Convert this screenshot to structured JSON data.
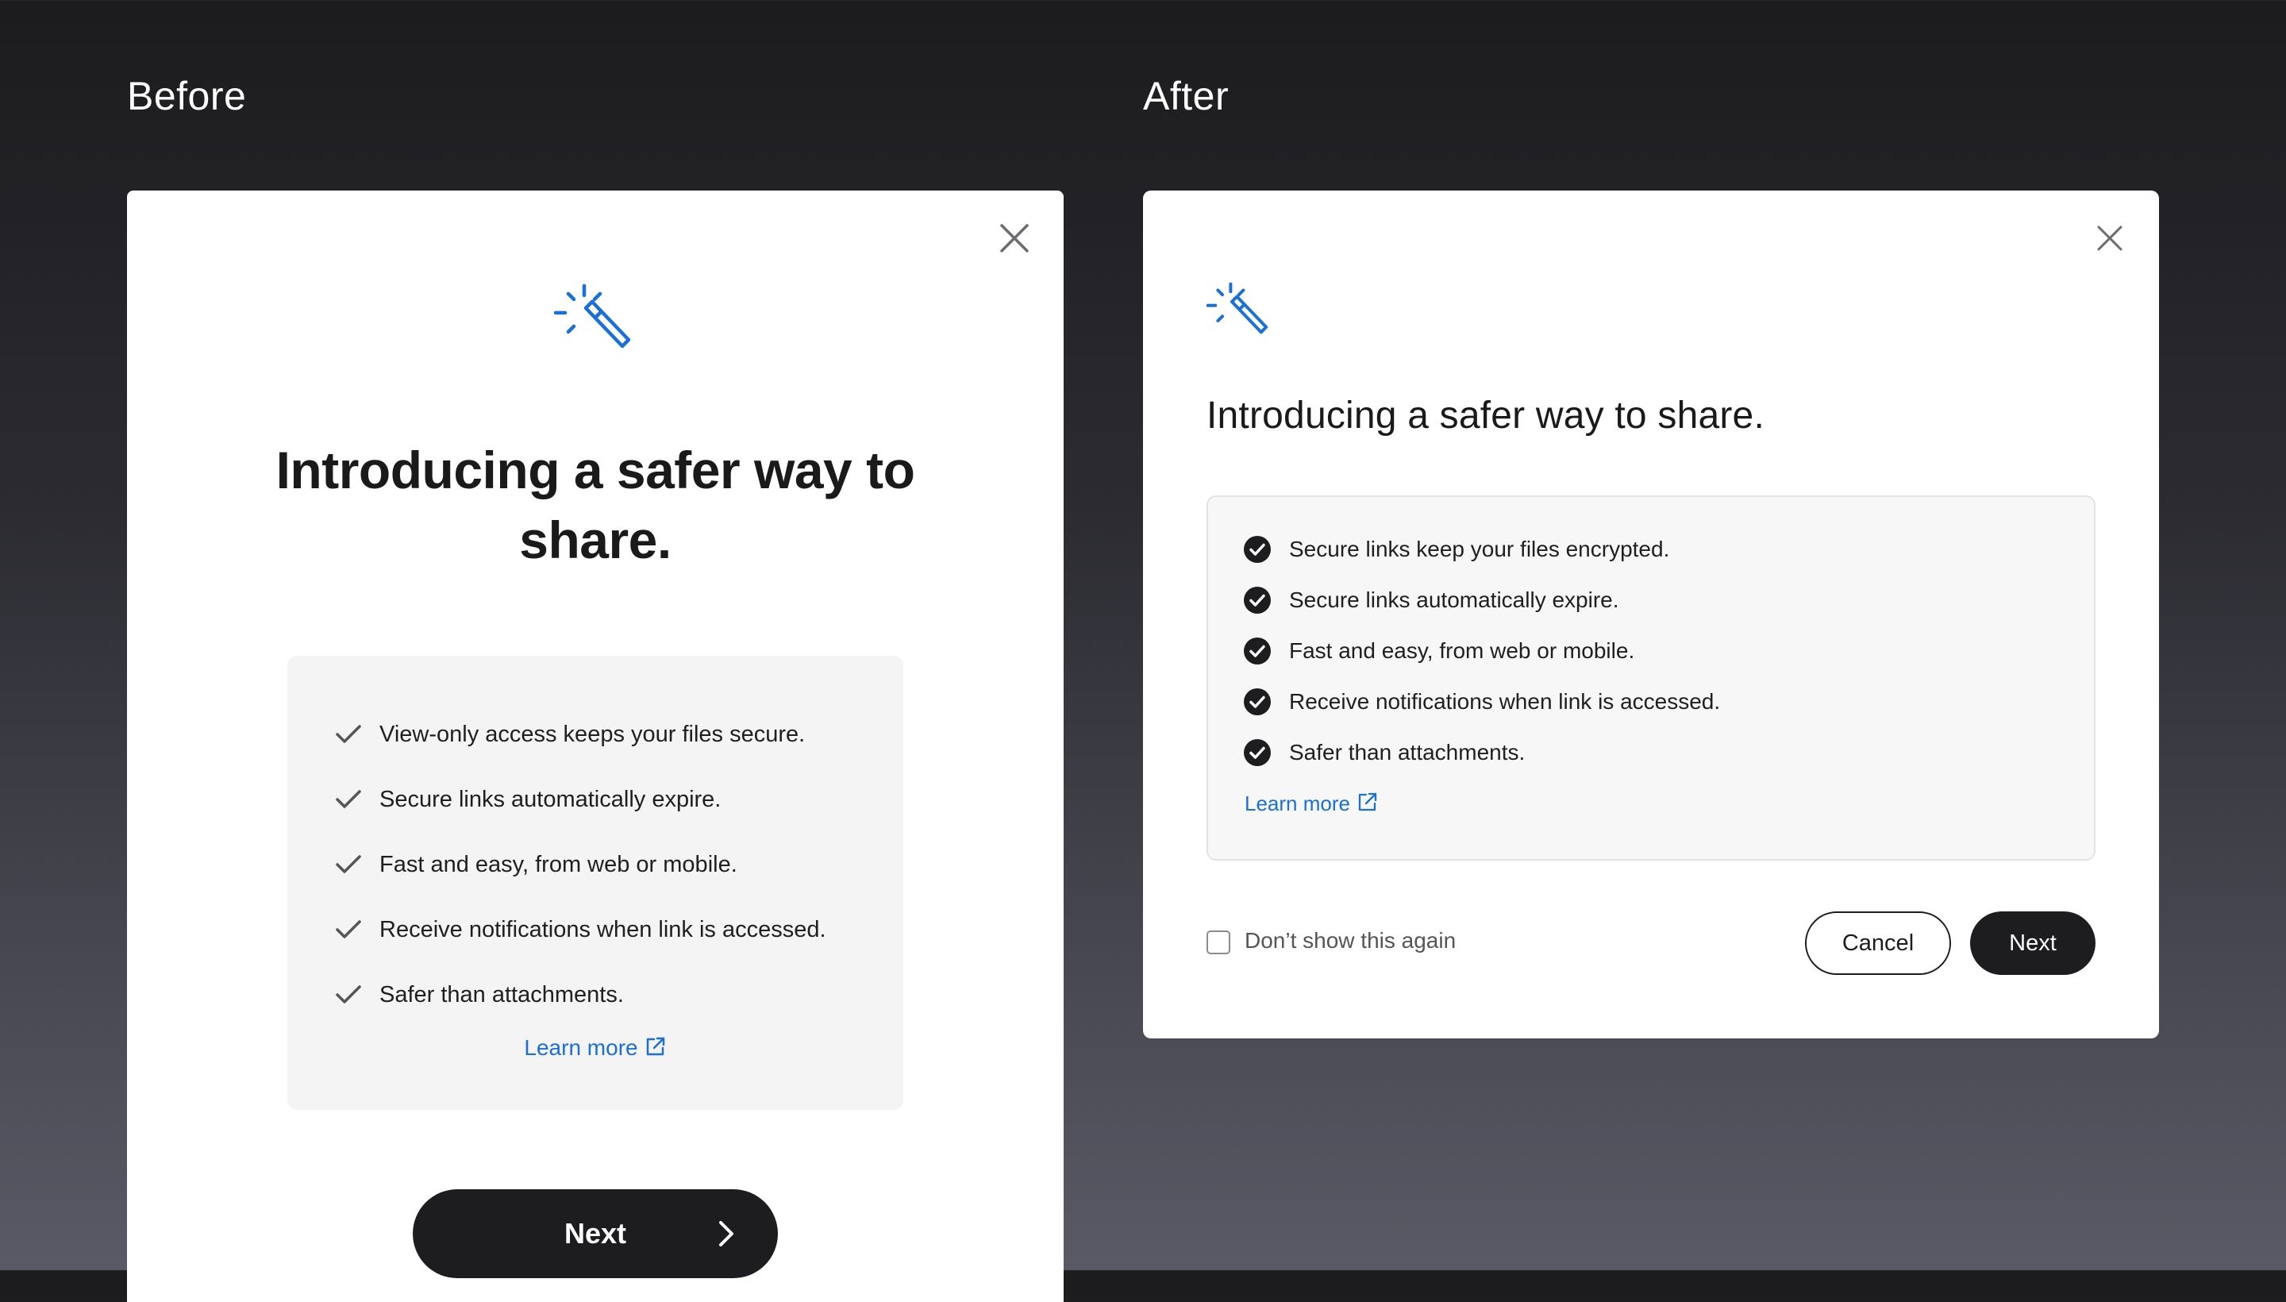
{
  "labels": {
    "before": "Before",
    "after": "After"
  },
  "before": {
    "title": "Introducing a safer way to share.",
    "features": [
      "View-only access keeps your files secure.",
      "Secure links automatically expire.",
      "Fast and easy, from web or mobile.",
      "Receive notifications when link is accessed.",
      "Safer than attachments."
    ],
    "learn_more": "Learn more",
    "next_label": "Next"
  },
  "after": {
    "title": "Introducing a safer way to share.",
    "features": [
      "Secure links keep your files encrypted.",
      "Secure links automatically expire.",
      "Fast and easy, from web or mobile.",
      "Receive notifications when link is accessed.",
      "Safer than attachments."
    ],
    "learn_more": "Learn more",
    "dont_show": "Don’t show this again",
    "dont_show_checked": false,
    "cancel_label": "Cancel",
    "next_label": "Next"
  },
  "icons": {
    "wand": "magic-wand-icon",
    "close": "close-icon",
    "check": "check-icon",
    "check_circle": "check-circle-icon",
    "external": "external-link-icon",
    "chevron": "chevron-right-icon"
  },
  "colors": {
    "accent": "#1b6fd9",
    "button_dark": "#1d1d1f",
    "box_bg": "#f4f4f5"
  }
}
